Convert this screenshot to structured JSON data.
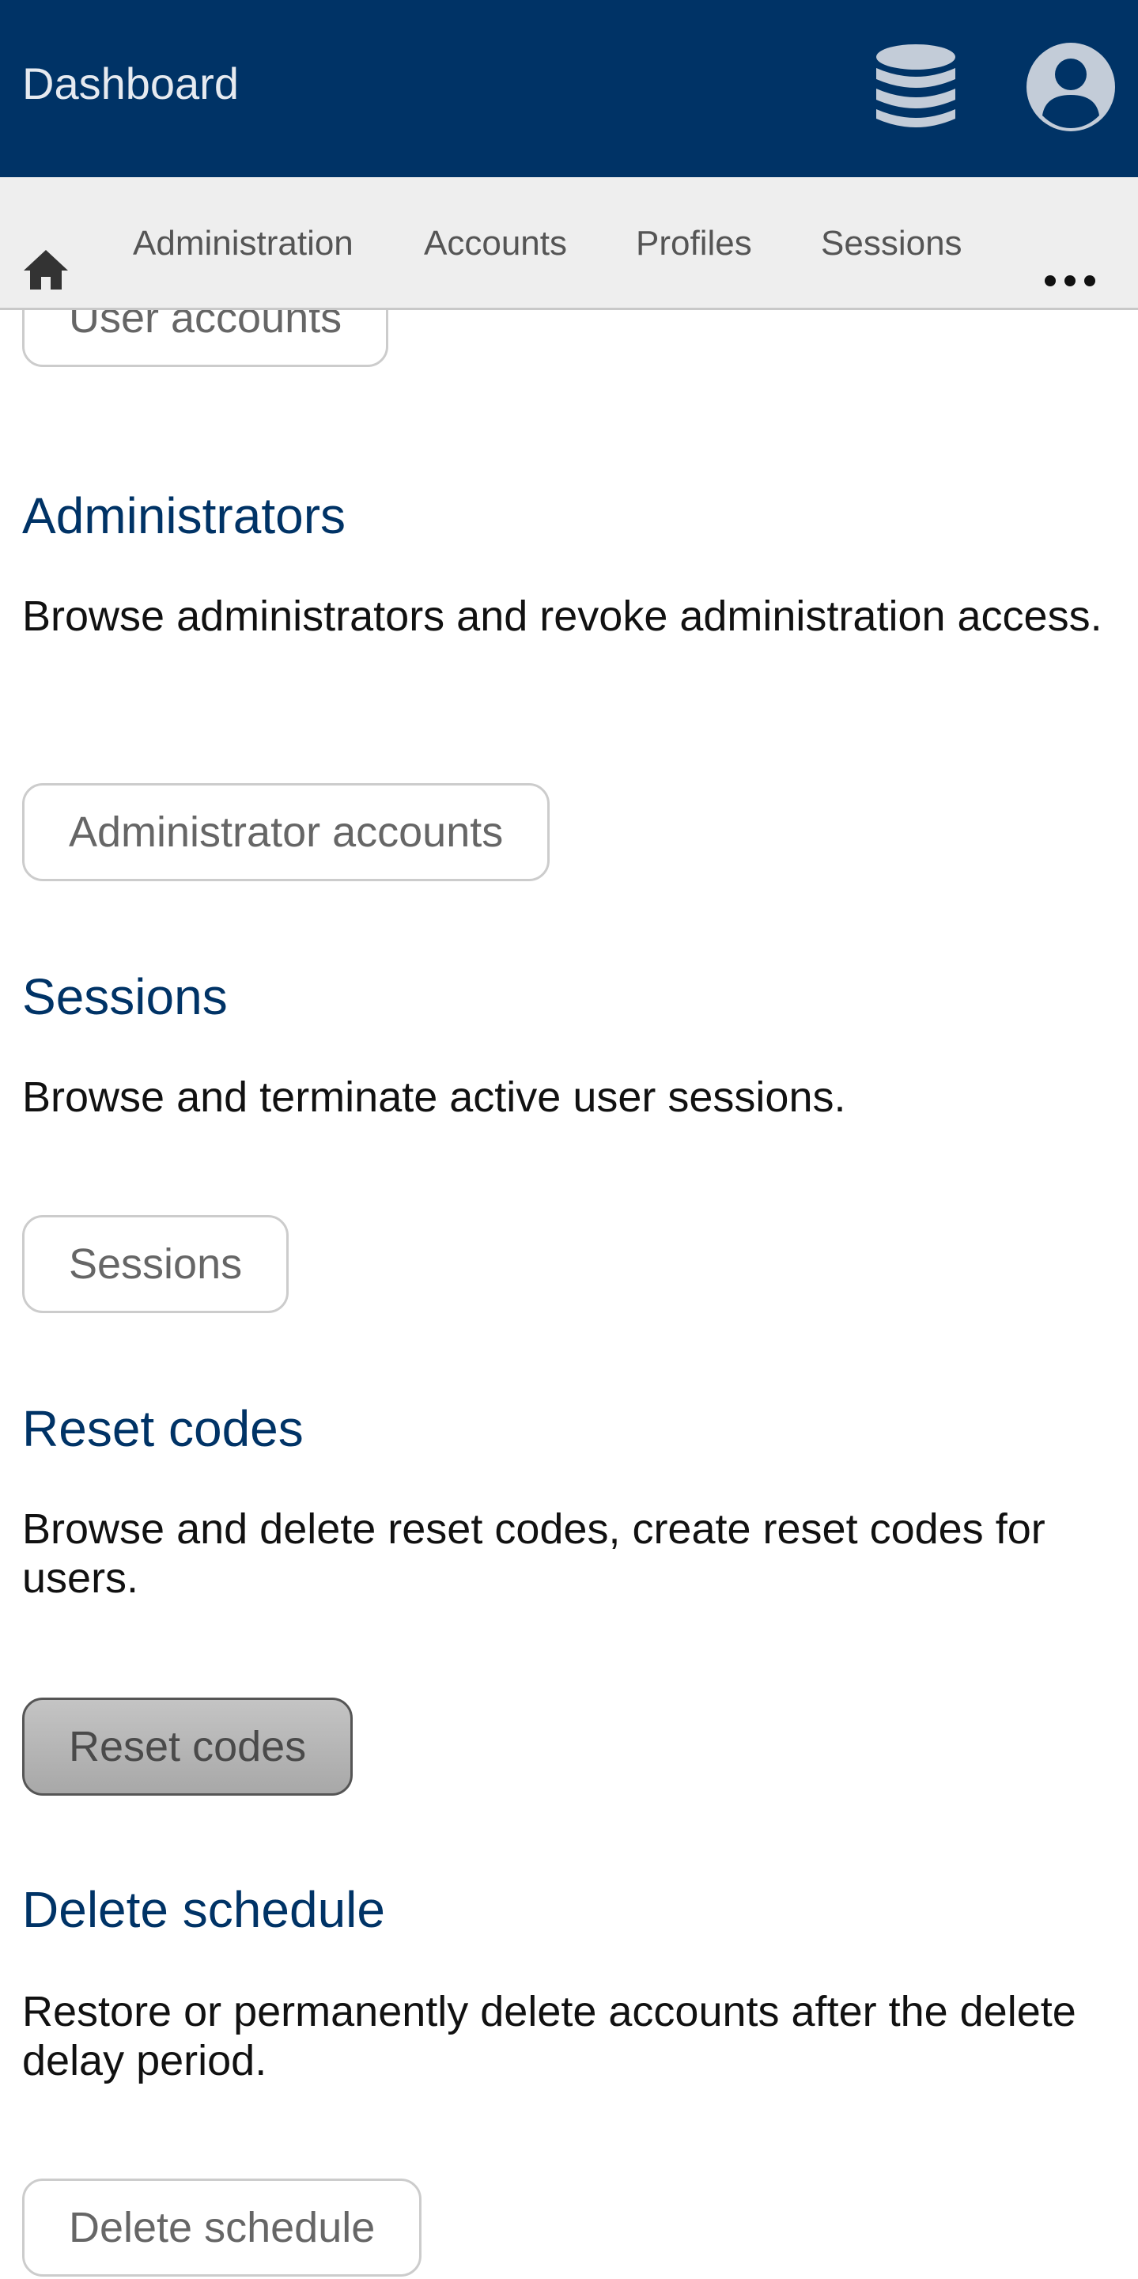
{
  "header": {
    "title": "Dashboard",
    "database_icon": "database-icon",
    "account_icon": "user-circle-icon",
    "background_color": "#003366"
  },
  "nav": {
    "home_icon": "home-icon",
    "items": [
      {
        "label": "Administration"
      },
      {
        "label": "Accounts"
      },
      {
        "label": "Profiles"
      },
      {
        "label": "Sessions"
      }
    ],
    "more_icon": "more-icon"
  },
  "sections": {
    "users": {
      "button_label": "User accounts"
    },
    "administrators": {
      "title": "Administrators",
      "description": "Browse administrators and revoke administration access.",
      "button_label": "Administrator accounts"
    },
    "sessions": {
      "title": "Sessions",
      "description": "Browse and terminate active user sessions.",
      "button_label": "Sessions"
    },
    "reset_codes": {
      "title": "Reset codes",
      "description": "Browse and delete reset codes, create reset codes for users.",
      "button_label": "Reset codes"
    },
    "delete_schedule": {
      "title": "Delete schedule",
      "description": "Restore or permanently delete accounts after the delete delay period.",
      "button_label": "Delete schedule"
    }
  },
  "colors": {
    "accent": "#003366",
    "nav_background": "#eeeeee"
  }
}
